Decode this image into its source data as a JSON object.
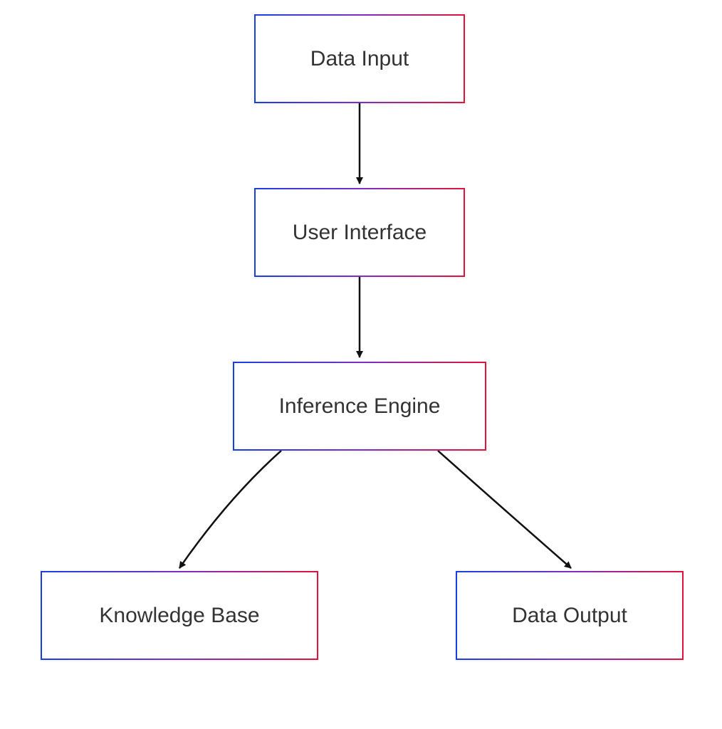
{
  "diagram": {
    "nodes": {
      "data_input": "Data Input",
      "user_interface": "User Interface",
      "inference_engine": "Inference Engine",
      "knowledge_base": "Knowledge Base",
      "data_output": "Data Output"
    },
    "edges": [
      {
        "from": "data_input",
        "to": "user_interface"
      },
      {
        "from": "user_interface",
        "to": "inference_engine"
      },
      {
        "from": "inference_engine",
        "to": "knowledge_base"
      },
      {
        "from": "inference_engine",
        "to": "data_output"
      }
    ],
    "colors": {
      "gradient_start": "#1a3fe0",
      "gradient_mid": "#7a2fc7",
      "gradient_end": "#e0143c",
      "text": "#333333",
      "arrow": "#111111"
    }
  }
}
